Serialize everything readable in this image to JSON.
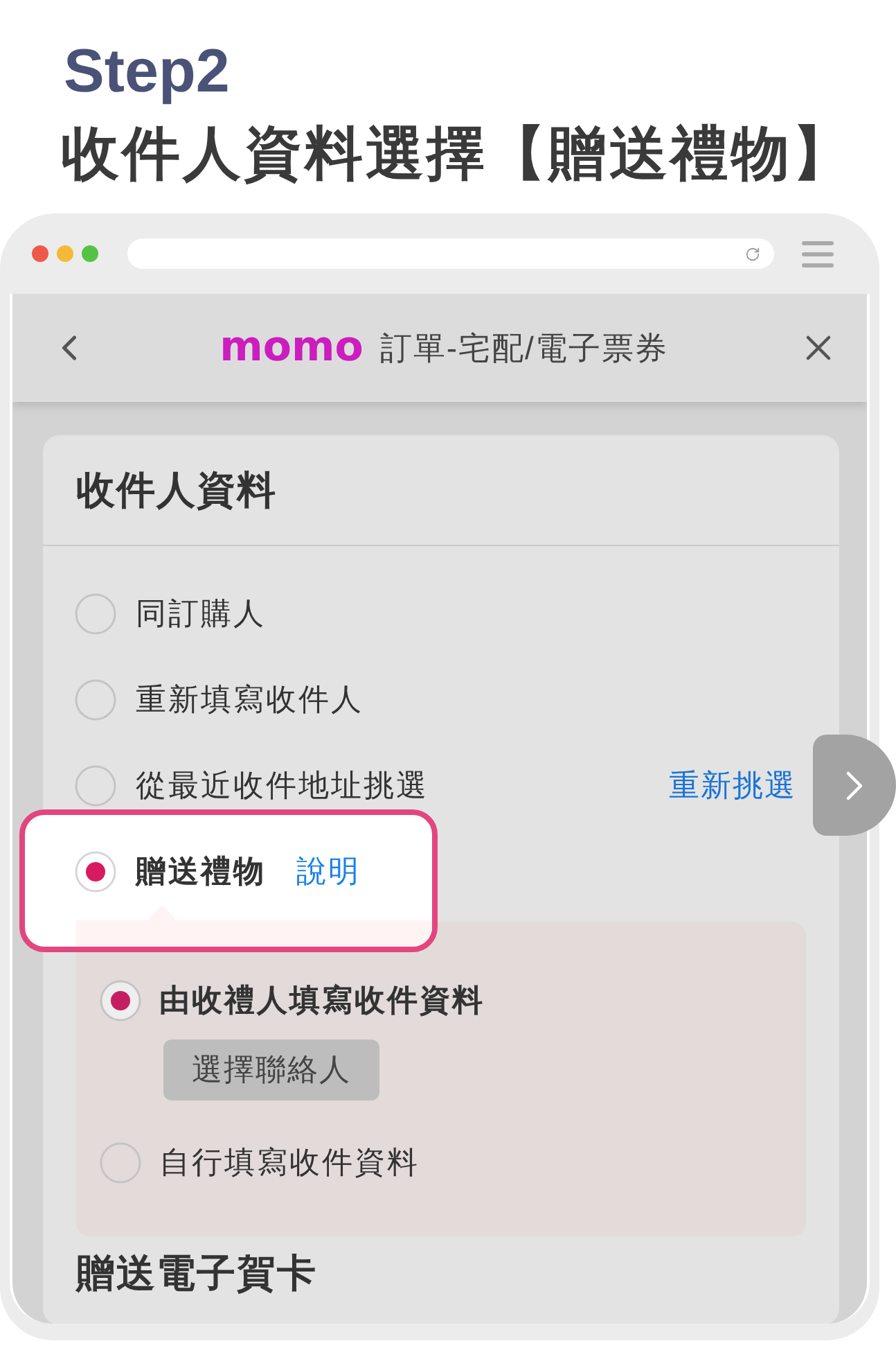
{
  "heading": {
    "step": "Step2",
    "title": "收件人資料選擇【贈送禮物】"
  },
  "browser": {
    "nav": {
      "logo": "momo",
      "title": "訂單-宅配/電子票券"
    }
  },
  "card": {
    "title": "收件人資料",
    "options": [
      {
        "label": "同訂購人",
        "selected": false,
        "highlighted": false
      },
      {
        "label": "重新填寫收件人",
        "selected": false,
        "highlighted": false
      },
      {
        "label": "從最近收件地址挑選",
        "selected": false,
        "highlighted": false,
        "link": {
          "text": "重新挑選",
          "kind": "action"
        }
      },
      {
        "label": "贈送禮物",
        "selected": true,
        "highlighted": true,
        "link": {
          "text": "說明",
          "kind": "help"
        }
      }
    ]
  },
  "gift_panel": {
    "options": [
      {
        "label": "由收禮人填寫收件資料",
        "selected": true,
        "button": "選擇聯絡人"
      },
      {
        "label": "自行填寫收件資料",
        "selected": false
      }
    ]
  },
  "next_section": {
    "title": "贈送電子賀卡"
  }
}
